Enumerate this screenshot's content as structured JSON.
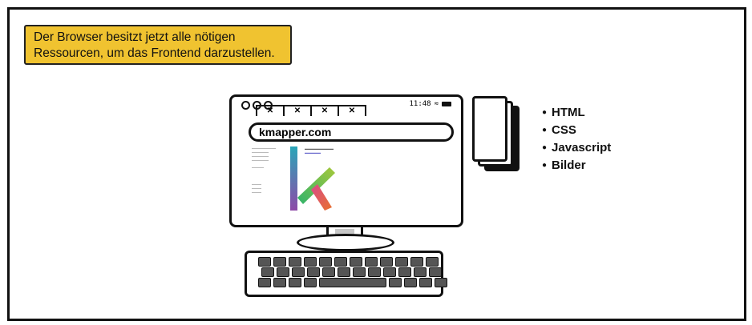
{
  "caption": {
    "line1": "Der Browser besitzt jetzt alle nötigen",
    "line2": "Ressourcen, um das Frontend darzustellen."
  },
  "browser": {
    "url": "kmapper.com",
    "tab_close_glyph": "✕",
    "time": "11:48"
  },
  "resources": [
    "HTML",
    "CSS",
    "Javascript",
    "Bilder"
  ],
  "colors": {
    "caption_bg": "#f0c330",
    "logo_teal": "#2aa6b8",
    "logo_purple": "#8e4aa8",
    "logo_green": "#a6c83a",
    "logo_orange": "#e8712e"
  }
}
